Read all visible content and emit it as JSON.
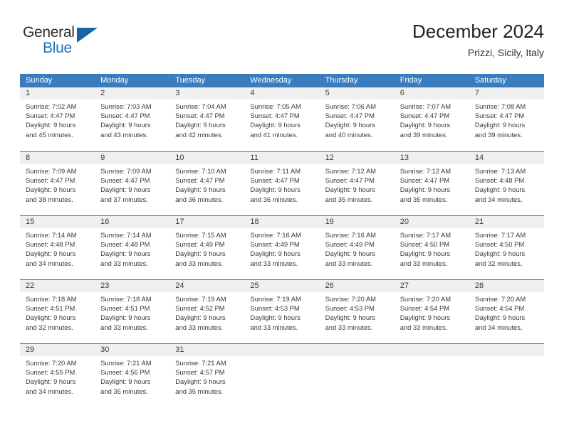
{
  "brand": {
    "name_top": "General",
    "name_bottom": "Blue",
    "accent_color": "#1b72b8",
    "triangle_color": "#1565a8"
  },
  "header": {
    "title": "December 2024",
    "subtitle": "Prizzi, Sicily, Italy"
  },
  "calendar": {
    "header_bg": "#3a7dbf",
    "day_strip_bg": "#f0f0f0",
    "weekday_headers": [
      "Sunday",
      "Monday",
      "Tuesday",
      "Wednesday",
      "Thursday",
      "Friday",
      "Saturday"
    ],
    "weeks": [
      [
        {
          "day": "1",
          "sunrise": "Sunrise: 7:02 AM",
          "sunset": "Sunset: 4:47 PM",
          "daylight_line1": "Daylight: 9 hours",
          "daylight_line2": "and 45 minutes."
        },
        {
          "day": "2",
          "sunrise": "Sunrise: 7:03 AM",
          "sunset": "Sunset: 4:47 PM",
          "daylight_line1": "Daylight: 9 hours",
          "daylight_line2": "and 43 minutes."
        },
        {
          "day": "3",
          "sunrise": "Sunrise: 7:04 AM",
          "sunset": "Sunset: 4:47 PM",
          "daylight_line1": "Daylight: 9 hours",
          "daylight_line2": "and 42 minutes."
        },
        {
          "day": "4",
          "sunrise": "Sunrise: 7:05 AM",
          "sunset": "Sunset: 4:47 PM",
          "daylight_line1": "Daylight: 9 hours",
          "daylight_line2": "and 41 minutes."
        },
        {
          "day": "5",
          "sunrise": "Sunrise: 7:06 AM",
          "sunset": "Sunset: 4:47 PM",
          "daylight_line1": "Daylight: 9 hours",
          "daylight_line2": "and 40 minutes."
        },
        {
          "day": "6",
          "sunrise": "Sunrise: 7:07 AM",
          "sunset": "Sunset: 4:47 PM",
          "daylight_line1": "Daylight: 9 hours",
          "daylight_line2": "and 39 minutes."
        },
        {
          "day": "7",
          "sunrise": "Sunrise: 7:08 AM",
          "sunset": "Sunset: 4:47 PM",
          "daylight_line1": "Daylight: 9 hours",
          "daylight_line2": "and 39 minutes."
        }
      ],
      [
        {
          "day": "8",
          "sunrise": "Sunrise: 7:09 AM",
          "sunset": "Sunset: 4:47 PM",
          "daylight_line1": "Daylight: 9 hours",
          "daylight_line2": "and 38 minutes."
        },
        {
          "day": "9",
          "sunrise": "Sunrise: 7:09 AM",
          "sunset": "Sunset: 4:47 PM",
          "daylight_line1": "Daylight: 9 hours",
          "daylight_line2": "and 37 minutes."
        },
        {
          "day": "10",
          "sunrise": "Sunrise: 7:10 AM",
          "sunset": "Sunset: 4:47 PM",
          "daylight_line1": "Daylight: 9 hours",
          "daylight_line2": "and 36 minutes."
        },
        {
          "day": "11",
          "sunrise": "Sunrise: 7:11 AM",
          "sunset": "Sunset: 4:47 PM",
          "daylight_line1": "Daylight: 9 hours",
          "daylight_line2": "and 36 minutes."
        },
        {
          "day": "12",
          "sunrise": "Sunrise: 7:12 AM",
          "sunset": "Sunset: 4:47 PM",
          "daylight_line1": "Daylight: 9 hours",
          "daylight_line2": "and 35 minutes."
        },
        {
          "day": "13",
          "sunrise": "Sunrise: 7:12 AM",
          "sunset": "Sunset: 4:47 PM",
          "daylight_line1": "Daylight: 9 hours",
          "daylight_line2": "and 35 minutes."
        },
        {
          "day": "14",
          "sunrise": "Sunrise: 7:13 AM",
          "sunset": "Sunset: 4:48 PM",
          "daylight_line1": "Daylight: 9 hours",
          "daylight_line2": "and 34 minutes."
        }
      ],
      [
        {
          "day": "15",
          "sunrise": "Sunrise: 7:14 AM",
          "sunset": "Sunset: 4:48 PM",
          "daylight_line1": "Daylight: 9 hours",
          "daylight_line2": "and 34 minutes."
        },
        {
          "day": "16",
          "sunrise": "Sunrise: 7:14 AM",
          "sunset": "Sunset: 4:48 PM",
          "daylight_line1": "Daylight: 9 hours",
          "daylight_line2": "and 33 minutes."
        },
        {
          "day": "17",
          "sunrise": "Sunrise: 7:15 AM",
          "sunset": "Sunset: 4:49 PM",
          "daylight_line1": "Daylight: 9 hours",
          "daylight_line2": "and 33 minutes."
        },
        {
          "day": "18",
          "sunrise": "Sunrise: 7:16 AM",
          "sunset": "Sunset: 4:49 PM",
          "daylight_line1": "Daylight: 9 hours",
          "daylight_line2": "and 33 minutes."
        },
        {
          "day": "19",
          "sunrise": "Sunrise: 7:16 AM",
          "sunset": "Sunset: 4:49 PM",
          "daylight_line1": "Daylight: 9 hours",
          "daylight_line2": "and 33 minutes."
        },
        {
          "day": "20",
          "sunrise": "Sunrise: 7:17 AM",
          "sunset": "Sunset: 4:50 PM",
          "daylight_line1": "Daylight: 9 hours",
          "daylight_line2": "and 33 minutes."
        },
        {
          "day": "21",
          "sunrise": "Sunrise: 7:17 AM",
          "sunset": "Sunset: 4:50 PM",
          "daylight_line1": "Daylight: 9 hours",
          "daylight_line2": "and 32 minutes."
        }
      ],
      [
        {
          "day": "22",
          "sunrise": "Sunrise: 7:18 AM",
          "sunset": "Sunset: 4:51 PM",
          "daylight_line1": "Daylight: 9 hours",
          "daylight_line2": "and 32 minutes."
        },
        {
          "day": "23",
          "sunrise": "Sunrise: 7:18 AM",
          "sunset": "Sunset: 4:51 PM",
          "daylight_line1": "Daylight: 9 hours",
          "daylight_line2": "and 33 minutes."
        },
        {
          "day": "24",
          "sunrise": "Sunrise: 7:19 AM",
          "sunset": "Sunset: 4:52 PM",
          "daylight_line1": "Daylight: 9 hours",
          "daylight_line2": "and 33 minutes."
        },
        {
          "day": "25",
          "sunrise": "Sunrise: 7:19 AM",
          "sunset": "Sunset: 4:53 PM",
          "daylight_line1": "Daylight: 9 hours",
          "daylight_line2": "and 33 minutes."
        },
        {
          "day": "26",
          "sunrise": "Sunrise: 7:20 AM",
          "sunset": "Sunset: 4:53 PM",
          "daylight_line1": "Daylight: 9 hours",
          "daylight_line2": "and 33 minutes."
        },
        {
          "day": "27",
          "sunrise": "Sunrise: 7:20 AM",
          "sunset": "Sunset: 4:54 PM",
          "daylight_line1": "Daylight: 9 hours",
          "daylight_line2": "and 33 minutes."
        },
        {
          "day": "28",
          "sunrise": "Sunrise: 7:20 AM",
          "sunset": "Sunset: 4:54 PM",
          "daylight_line1": "Daylight: 9 hours",
          "daylight_line2": "and 34 minutes."
        }
      ],
      [
        {
          "day": "29",
          "sunrise": "Sunrise: 7:20 AM",
          "sunset": "Sunset: 4:55 PM",
          "daylight_line1": "Daylight: 9 hours",
          "daylight_line2": "and 34 minutes."
        },
        {
          "day": "30",
          "sunrise": "Sunrise: 7:21 AM",
          "sunset": "Sunset: 4:56 PM",
          "daylight_line1": "Daylight: 9 hours",
          "daylight_line2": "and 35 minutes."
        },
        {
          "day": "31",
          "sunrise": "Sunrise: 7:21 AM",
          "sunset": "Sunset: 4:57 PM",
          "daylight_line1": "Daylight: 9 hours",
          "daylight_line2": "and 35 minutes."
        },
        {
          "day": "",
          "sunrise": "",
          "sunset": "",
          "daylight_line1": "",
          "daylight_line2": ""
        },
        {
          "day": "",
          "sunrise": "",
          "sunset": "",
          "daylight_line1": "",
          "daylight_line2": ""
        },
        {
          "day": "",
          "sunrise": "",
          "sunset": "",
          "daylight_line1": "",
          "daylight_line2": ""
        },
        {
          "day": "",
          "sunrise": "",
          "sunset": "",
          "daylight_line1": "",
          "daylight_line2": ""
        }
      ]
    ]
  }
}
